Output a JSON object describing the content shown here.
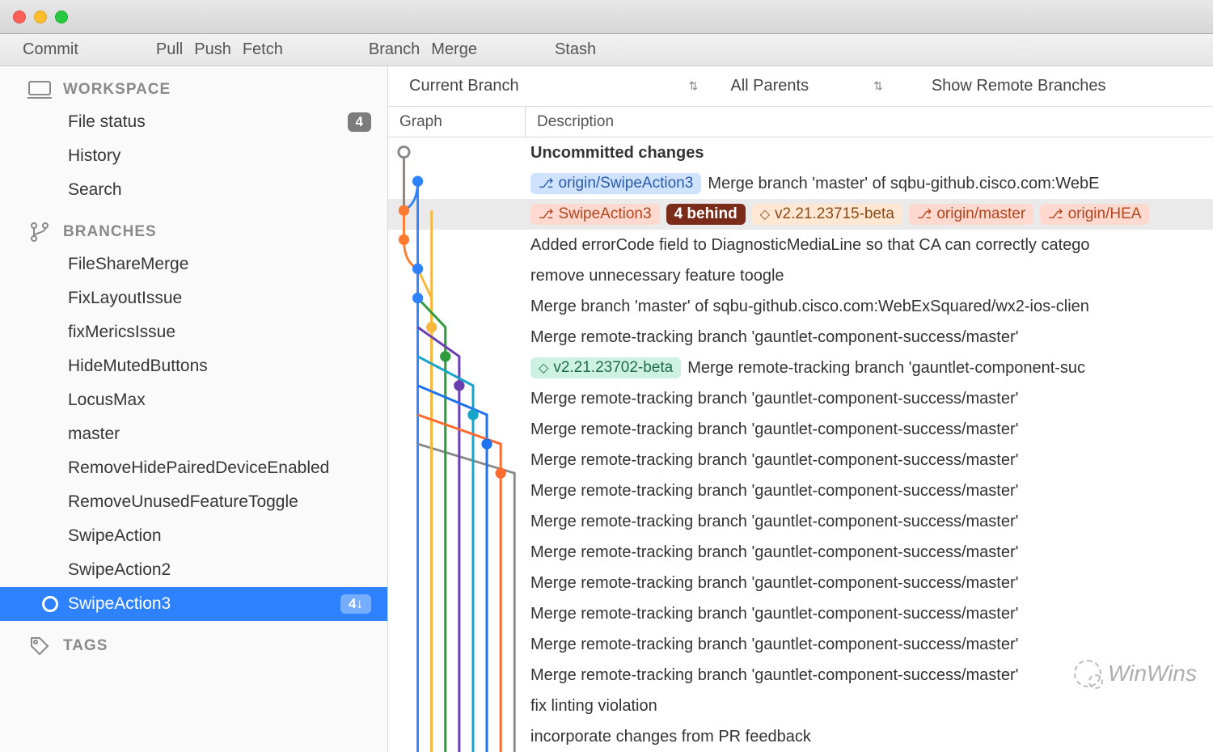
{
  "toolbar": {
    "commit": "Commit",
    "pull": "Pull",
    "push": "Push",
    "fetch": "Fetch",
    "branch": "Branch",
    "merge": "Merge",
    "stash": "Stash"
  },
  "sidebar": {
    "workspace": {
      "header": "WORKSPACE",
      "items": [
        {
          "label": "File status",
          "badge": "4"
        },
        {
          "label": "History"
        },
        {
          "label": "Search"
        }
      ]
    },
    "branches": {
      "header": "BRANCHES",
      "items": [
        {
          "label": "FileShareMerge"
        },
        {
          "label": "FixLayoutIssue"
        },
        {
          "label": "fixMericsIssue"
        },
        {
          "label": "HideMutedButtons"
        },
        {
          "label": "LocusMax"
        },
        {
          "label": "master"
        },
        {
          "label": "RemoveHidePairedDeviceEnabled"
        },
        {
          "label": "RemoveUnusedFeatureToggle"
        },
        {
          "label": "SwipeAction"
        },
        {
          "label": "SwipeAction2"
        },
        {
          "label": "SwipeAction3",
          "selected": true,
          "badge": "4↓"
        }
      ]
    },
    "tags": {
      "header": "TAGS"
    }
  },
  "filters": {
    "currentBranch": "Current Branch",
    "allParents": "All Parents",
    "showRemote": "Show Remote Branches"
  },
  "columns": {
    "graph": "Graph",
    "description": "Description"
  },
  "commits": [
    {
      "bold": true,
      "desc": "Uncommitted changes"
    },
    {
      "tags": [
        {
          "kind": "branch-remote",
          "label": "origin/SwipeAction3",
          "icon": "branch"
        }
      ],
      "desc": "Merge branch 'master' of sqbu-github.cisco.com:WebE"
    },
    {
      "selected": true,
      "tags": [
        {
          "kind": "branch-local",
          "label": "SwipeAction3",
          "icon": "branch"
        },
        {
          "kind": "behind",
          "label": "4 behind"
        },
        {
          "kind": "tag",
          "label": "v2.21.23715-beta",
          "icon": "tag"
        },
        {
          "kind": "branch-local",
          "label": "origin/master",
          "icon": "branch"
        },
        {
          "kind": "branch-local",
          "label": "origin/HEA",
          "icon": "branch"
        }
      ],
      "desc": ""
    },
    {
      "desc": "Added errorCode field to DiagnosticMediaLine so that CA can correctly catego"
    },
    {
      "desc": "remove unnecessary feature toogle"
    },
    {
      "desc": "Merge branch 'master' of sqbu-github.cisco.com:WebExSquared/wx2-ios-clien"
    },
    {
      "desc": "Merge remote-tracking branch 'gauntlet-component-success/master'"
    },
    {
      "tags": [
        {
          "kind": "tag-green",
          "label": "v2.21.23702-beta",
          "icon": "tag"
        }
      ],
      "desc": "Merge remote-tracking branch 'gauntlet-component-suc"
    },
    {
      "desc": "Merge remote-tracking branch 'gauntlet-component-success/master'"
    },
    {
      "desc": "Merge remote-tracking branch 'gauntlet-component-success/master'"
    },
    {
      "desc": "Merge remote-tracking branch 'gauntlet-component-success/master'"
    },
    {
      "desc": "Merge remote-tracking branch 'gauntlet-component-success/master'"
    },
    {
      "desc": "Merge remote-tracking branch 'gauntlet-component-success/master'"
    },
    {
      "desc": "Merge remote-tracking branch 'gauntlet-component-success/master'"
    },
    {
      "desc": "Merge remote-tracking branch 'gauntlet-component-success/master'"
    },
    {
      "desc": "Merge remote-tracking branch 'gauntlet-component-success/master'"
    },
    {
      "desc": "Merge remote-tracking branch 'gauntlet-component-success/master'"
    },
    {
      "desc": "Merge remote-tracking branch 'gauntlet-component-success/master'"
    },
    {
      "desc": "fix linting violation"
    },
    {
      "desc": "incorporate changes from PR feedback"
    }
  ],
  "graph": {
    "colors": [
      "#888888",
      "#2f82ff",
      "#ff7a2f",
      "#f6b83c",
      "#2f9b3d",
      "#6a3fb0",
      "#17a4c9",
      "#1e73f0",
      "#ff6a2f"
    ],
    "lane_x": [
      16,
      34,
      52,
      70,
      88,
      106,
      124,
      142,
      160
    ],
    "nodes": [
      {
        "row": 0,
        "lane": 0,
        "color": 0,
        "hollow": true
      },
      {
        "row": 1,
        "lane": 1,
        "color": 1
      },
      {
        "row": 2,
        "lane": 0,
        "color": 2
      },
      {
        "row": 3,
        "lane": 0,
        "color": 2
      },
      {
        "row": 4,
        "lane": 1,
        "color": 1
      },
      {
        "row": 5,
        "lane": 1,
        "color": 1
      },
      {
        "row": 6,
        "lane": 2,
        "color": 3
      },
      {
        "row": 7,
        "lane": 3,
        "color": 4
      },
      {
        "row": 8,
        "lane": 4,
        "color": 5
      },
      {
        "row": 9,
        "lane": 5,
        "color": 6
      },
      {
        "row": 10,
        "lane": 6,
        "color": 7
      },
      {
        "row": 11,
        "lane": 7,
        "color": 8
      }
    ]
  },
  "watermark": "WinWins"
}
